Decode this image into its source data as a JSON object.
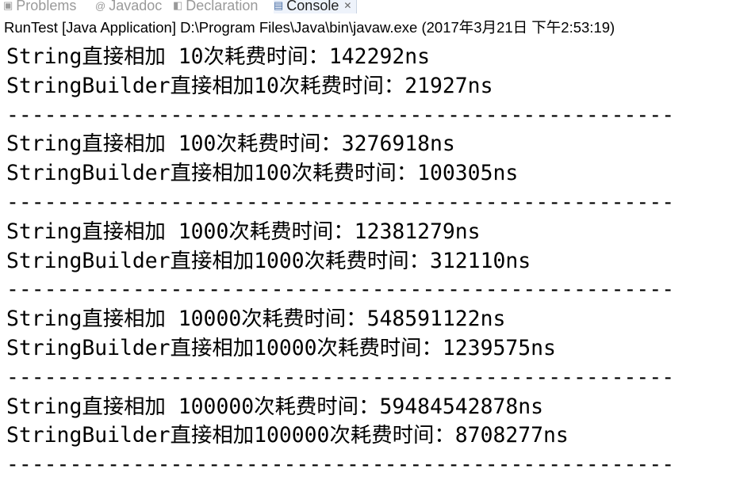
{
  "tabs": [
    {
      "label": "Problems",
      "icon": "problems-icon",
      "active": false
    },
    {
      "label": "Javadoc",
      "icon": "at-sign-icon",
      "active": false
    },
    {
      "label": "Declaration",
      "icon": "declaration-icon",
      "active": false
    },
    {
      "label": "Console",
      "icon": "console-icon",
      "active": true
    }
  ],
  "status_line": "RunTest [Java Application] D:\\Program Files\\Java\\bin\\javaw.exe (2017年3月21日 下午2:53:19)",
  "console_lines": [
    "String直接相加 10次耗费时间：142292ns",
    "StringBuilder直接相加10次耗费时间：21927ns",
    "-----------------------------------------------------",
    "String直接相加 100次耗费时间：3276918ns",
    "StringBuilder直接相加100次耗费时间：100305ns",
    "-----------------------------------------------------",
    "String直接相加 1000次耗费时间：12381279ns",
    "StringBuilder直接相加1000次耗费时间：312110ns",
    "-----------------------------------------------------",
    "String直接相加 10000次耗费时间：548591122ns",
    "StringBuilder直接相加10000次耗费时间：1239575ns",
    "-----------------------------------------------------",
    "String直接相加 100000次耗费时间：59484542878ns",
    "StringBuilder直接相加100000次耗费时间：8708277ns",
    "-----------------------------------------------------"
  ]
}
